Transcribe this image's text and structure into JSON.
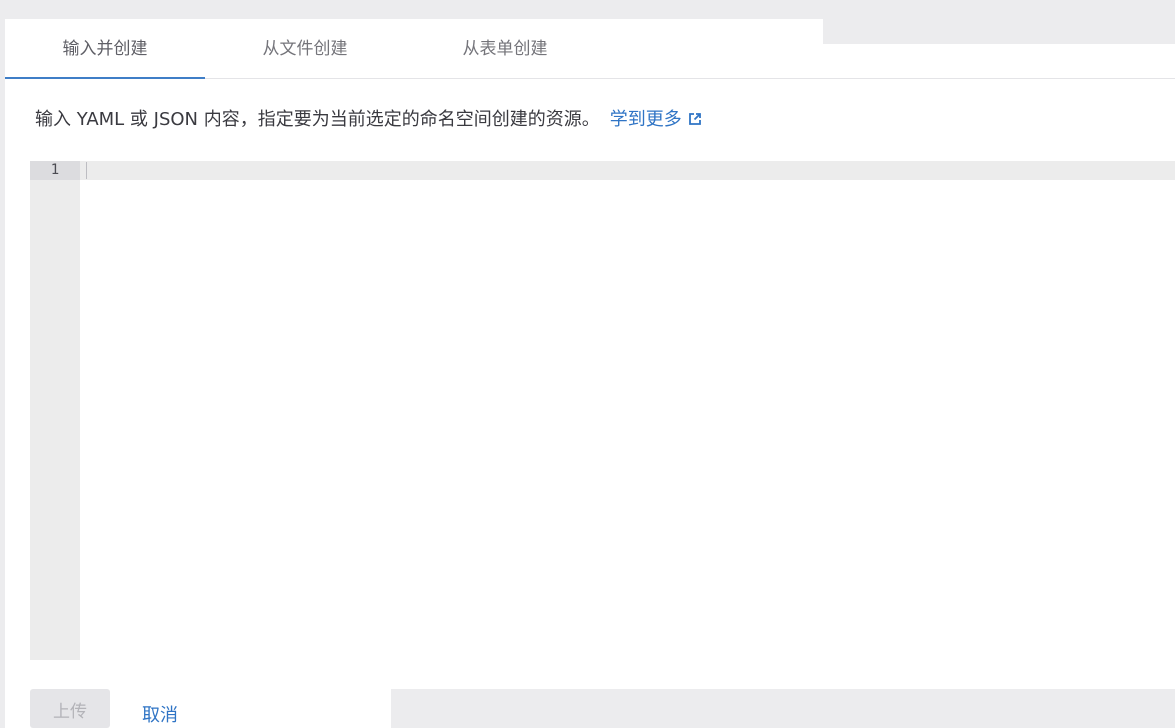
{
  "tabs": [
    {
      "label": "输入并创建",
      "active": true
    },
    {
      "label": "从文件创建",
      "active": false
    },
    {
      "label": "从表单创建",
      "active": false
    }
  ],
  "description": {
    "text": "输入 YAML 或 JSON 内容，指定要为当前选定的命名空间创建的资源。",
    "learn_more_label": "学到更多",
    "learn_more_icon": "external-link-icon"
  },
  "editor": {
    "line_numbers": [
      "1"
    ],
    "content": ""
  },
  "footer": {
    "upload_label": "上传",
    "cancel_label": "取消"
  },
  "colors": {
    "accent": "#3f7ec7",
    "link": "#2f74c5",
    "background": "#ececee",
    "editor_gutter": "#ececec"
  }
}
